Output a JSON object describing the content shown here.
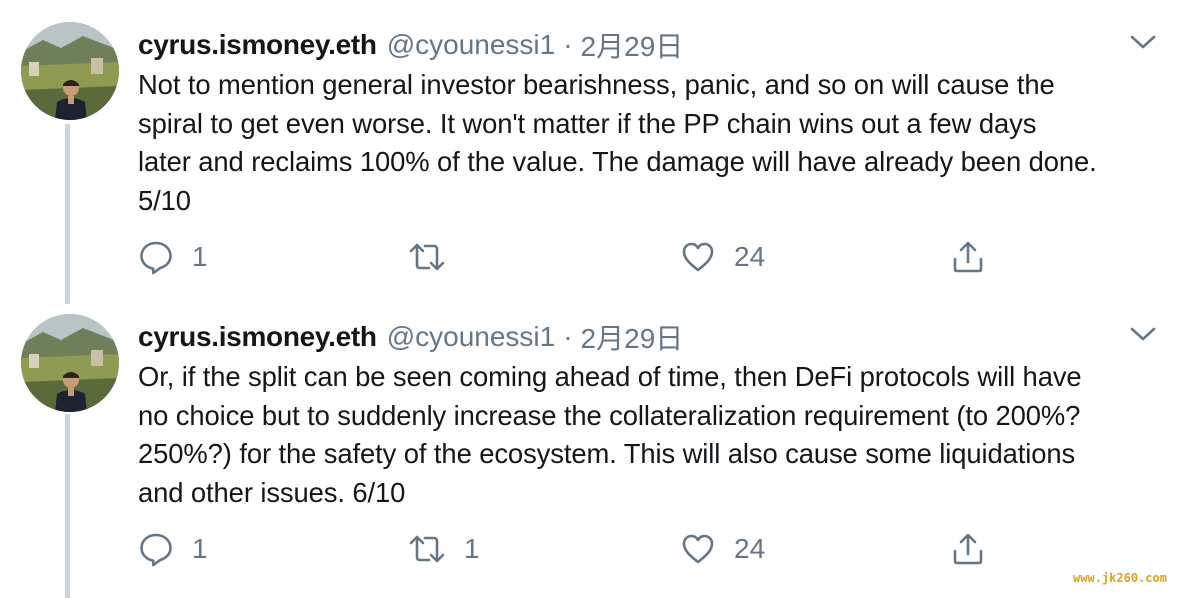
{
  "tweets": [
    {
      "display_name": "cyrus.ismoney.eth",
      "handle": "@cyounessi1",
      "separator": "·",
      "time": "2月29日",
      "text_lines": [
        "Not to mention general investor bearishness, panic, and so on will cause the",
        "spiral to get even worse. It won't matter if the PP chain wins out a few days",
        "later and reclaims 100% of the value. The damage will have already been done.",
        "5/10"
      ],
      "reply_count": "1",
      "retweet_count": "",
      "like_count": "24",
      "icons": {
        "more": "chevron-down-icon",
        "reply": "reply-icon",
        "retweet": "retweet-icon",
        "like": "heart-icon",
        "share": "share-icon"
      }
    },
    {
      "display_name": "cyrus.ismoney.eth",
      "handle": "@cyounessi1",
      "separator": "·",
      "time": "2月29日",
      "text_lines": [
        "Or, if the split can be seen coming ahead of time, then DeFi protocols will have",
        "no choice but to suddenly increase the collateralization requirement (to 200%?",
        "250%?) for the safety of the ecosystem. This will also cause some liquidations",
        "and other issues. 6/10"
      ],
      "reply_count": "1",
      "retweet_count": "1",
      "like_count": "24",
      "icons": {
        "more": "chevron-down-icon",
        "reply": "reply-icon",
        "retweet": "retweet-icon",
        "like": "heart-icon",
        "share": "share-icon"
      }
    }
  ],
  "watermark": "www.jk260.com",
  "colors": {
    "text": "#14171a",
    "secondary": "#657786",
    "thread_line": "#ccd6dd",
    "watermark": "#e0a020"
  }
}
